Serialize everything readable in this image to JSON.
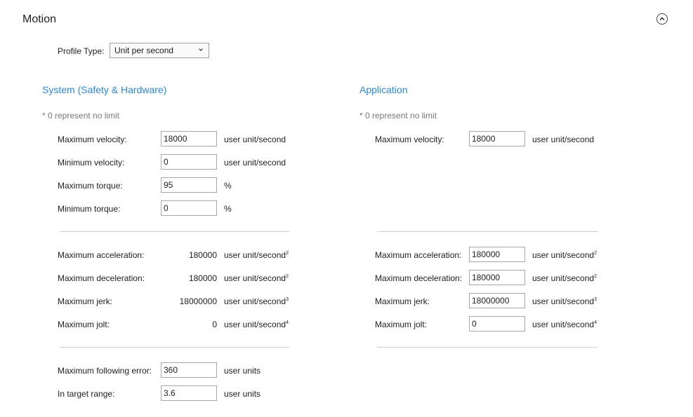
{
  "header": {
    "title": "Motion",
    "collapse_icon": "chevron-up-icon"
  },
  "profile": {
    "label": "Profile Type:",
    "selected": "Unit per second"
  },
  "system": {
    "title": "System (Safety & Hardware)",
    "note": "* 0 represent no limit",
    "max_velocity": {
      "label": "Maximum velocity:",
      "value": "18000",
      "unit": "user unit/second"
    },
    "min_velocity": {
      "label": "Minimum velocity:",
      "value": "0",
      "unit": "user unit/second"
    },
    "max_torque": {
      "label": "Maximum torque:",
      "value": "95",
      "unit": "%"
    },
    "min_torque": {
      "label": "Minimum torque:",
      "value": "0",
      "unit": "%"
    },
    "max_acceleration": {
      "label": "Maximum acceleration:",
      "value": "180000",
      "unit": "user unit/second",
      "exp": "2"
    },
    "max_deceleration": {
      "label": "Maximum deceleration:",
      "value": "180000",
      "unit": "user unit/second",
      "exp": "2"
    },
    "max_jerk": {
      "label": "Maximum jerk:",
      "value": "18000000",
      "unit": "user unit/second",
      "exp": "3"
    },
    "max_jolt": {
      "label": "Maximum jolt:",
      "value": "0",
      "unit": "user unit/second",
      "exp": "4"
    },
    "max_following_error": {
      "label": "Maximum following error:",
      "value": "360",
      "unit": "user units"
    },
    "in_target_range": {
      "label": "In target range:",
      "value": "3.6",
      "unit": "user units"
    }
  },
  "application": {
    "title": "Application",
    "note": "* 0 represent no limit",
    "max_velocity": {
      "label": "Maximum velocity:",
      "value": "18000",
      "unit": "user unit/second"
    },
    "max_acceleration": {
      "label": "Maximum acceleration:",
      "value": "180000",
      "unit": "user unit/second",
      "exp": "2"
    },
    "max_deceleration": {
      "label": "Maximum deceleration:",
      "value": "180000",
      "unit": "user unit/second",
      "exp": "2"
    },
    "max_jerk": {
      "label": "Maximum jerk:",
      "value": "18000000",
      "unit": "user unit/second",
      "exp": "3"
    },
    "max_jolt": {
      "label": "Maximum jolt:",
      "value": "0",
      "unit": "user unit/second",
      "exp": "4"
    }
  },
  "colors": {
    "accent": "#2b88d8",
    "note": "#777777",
    "divider": "#cfcfcf"
  }
}
